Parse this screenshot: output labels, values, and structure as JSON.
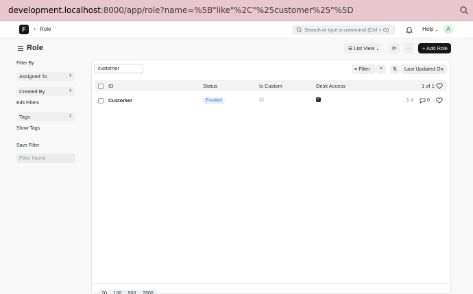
{
  "browser": {
    "url_host": "development.localhost",
    "url_rest": ":8000/app/role?name=%5B\"like\"%2C\"%25customer%25\"%5D"
  },
  "navbar": {
    "logo": "F",
    "breadcrumb": "Role",
    "search_placeholder": "Search or type a command (Ctrl + G)",
    "help_label": "Help",
    "avatar_initial": "A"
  },
  "page": {
    "title": "Role",
    "view_label": "List View",
    "more_label": "···",
    "add_label": "+ Add Role"
  },
  "sidebar": {
    "filter_by": "Filter By",
    "assigned_to": "Assigned To",
    "created_by": "Created By",
    "edit_filters": "Edit Filters",
    "tags": "Tags",
    "show_tags": "Show Tags",
    "save_filter": "Save Filter",
    "filter_name_placeholder": "Filter Name"
  },
  "list": {
    "search_value": "customer",
    "filter_label": "Filter",
    "clear_label": "×",
    "sort_label": "Last Updated On",
    "columns": [
      "ID",
      "Status",
      "Is Custom",
      "Desk Access"
    ],
    "count": "1 of 1",
    "rows": [
      {
        "id": "Customer",
        "status": "Enabled",
        "is_custom": false,
        "desk_access": true,
        "modified": "1 d",
        "comments": "0"
      }
    ],
    "page_sizes": [
      "20",
      "100",
      "500",
      "2500"
    ]
  },
  "colors": {
    "url_bar": "#e8c6cf",
    "status_enabled": "#2f6fd6",
    "primary_button": "#171717"
  }
}
